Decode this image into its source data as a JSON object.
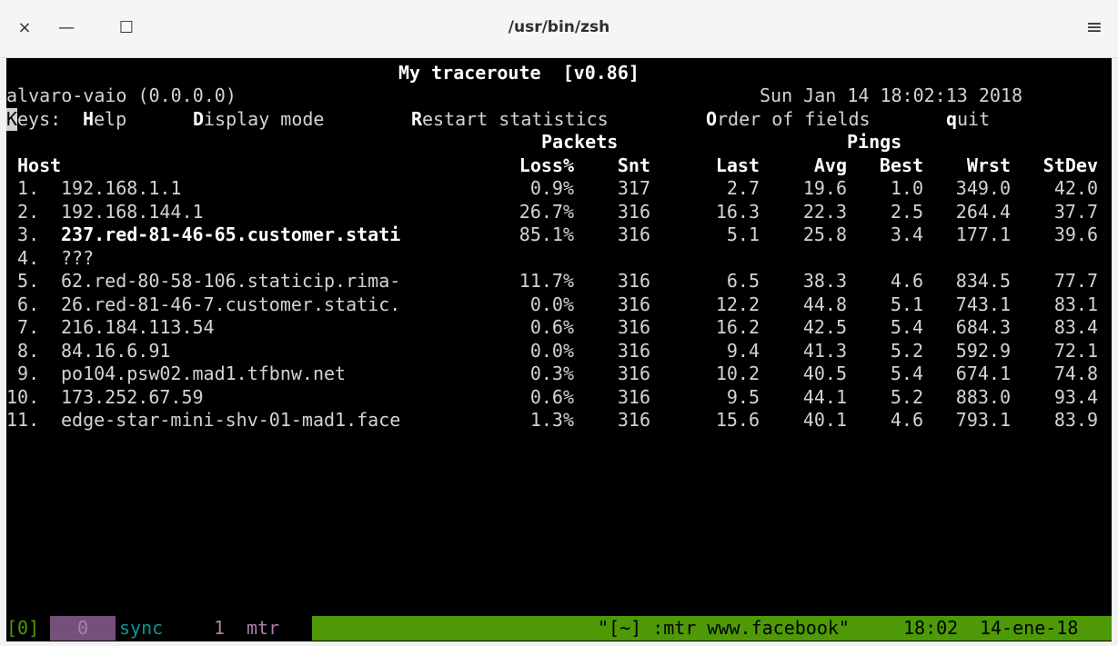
{
  "window": {
    "title": "/usr/bin/zsh",
    "close_glyph": "×",
    "minimize_glyph": "—",
    "maximize_glyph": "☐",
    "menu_glyph": "≡"
  },
  "mtr": {
    "title": "My traceroute  [v0.86]",
    "host_info": "alvaro-vaio (0.0.0.0)",
    "datetime": "Sun Jan 14 18:02:13 2018",
    "keys": {
      "label_first": "K",
      "label_rest": "eys:",
      "help_key": "H",
      "help_rest": "elp",
      "display_key": "D",
      "display_rest": "isplay mode",
      "restart_key": "R",
      "restart_rest": "estart statistics",
      "order_key": "O",
      "order_rest": "rder of fields",
      "quit_key": "q",
      "quit_rest": "uit"
    },
    "group_packets": "Packets",
    "group_pings": "Pings",
    "columns": {
      "host": "Host",
      "loss": "Loss%",
      "snt": "Snt",
      "last": "Last",
      "avg": "Avg",
      "best": "Best",
      "wrst": "Wrst",
      "stdev": "StDev"
    },
    "rows": [
      {
        "n": " 1.",
        "host": "192.168.1.1",
        "loss": "0.9%",
        "snt": "317",
        "last": "2.7",
        "avg": "19.6",
        "best": "1.0",
        "wrst": "349.0",
        "stdev": "42.0"
      },
      {
        "n": " 2.",
        "host": "192.168.144.1",
        "loss": "26.7%",
        "snt": "316",
        "last": "16.3",
        "avg": "22.3",
        "best": "2.5",
        "wrst": "264.4",
        "stdev": "37.7"
      },
      {
        "n": " 3.",
        "host": "237.red-81-46-65.customer.stati",
        "loss": "85.1%",
        "snt": "316",
        "last": "5.1",
        "avg": "25.8",
        "best": "3.4",
        "wrst": "177.1",
        "stdev": "39.6"
      },
      {
        "n": " 4.",
        "host": "???",
        "loss": "",
        "snt": "",
        "last": "",
        "avg": "",
        "best": "",
        "wrst": "",
        "stdev": ""
      },
      {
        "n": " 5.",
        "host": "62.red-80-58-106.staticip.rima-",
        "loss": "11.7%",
        "snt": "316",
        "last": "6.5",
        "avg": "38.3",
        "best": "4.6",
        "wrst": "834.5",
        "stdev": "77.7"
      },
      {
        "n": " 6.",
        "host": "26.red-81-46-7.customer.static.",
        "loss": "0.0%",
        "snt": "316",
        "last": "12.2",
        "avg": "44.8",
        "best": "5.1",
        "wrst": "743.1",
        "stdev": "83.1"
      },
      {
        "n": " 7.",
        "host": "216.184.113.54",
        "loss": "0.6%",
        "snt": "316",
        "last": "16.2",
        "avg": "42.5",
        "best": "5.4",
        "wrst": "684.3",
        "stdev": "83.4"
      },
      {
        "n": " 8.",
        "host": "84.16.6.91",
        "loss": "0.0%",
        "snt": "316",
        "last": "9.4",
        "avg": "41.3",
        "best": "5.2",
        "wrst": "592.9",
        "stdev": "72.1"
      },
      {
        "n": " 9.",
        "host": "po104.psw02.mad1.tfbnw.net",
        "loss": "0.3%",
        "snt": "316",
        "last": "10.2",
        "avg": "40.5",
        "best": "5.4",
        "wrst": "674.1",
        "stdev": "74.8"
      },
      {
        "n": "10.",
        "host": "173.252.67.59",
        "loss": "0.6%",
        "snt": "316",
        "last": "9.5",
        "avg": "44.1",
        "best": "5.2",
        "wrst": "883.0",
        "stdev": "93.4"
      },
      {
        "n": "11.",
        "host": "edge-star-mini-shv-01-mad1.face",
        "loss": "1.3%",
        "snt": "316",
        "last": "15.6",
        "avg": "40.1",
        "best": "4.6",
        "wrst": "793.1",
        "stdev": "83.9"
      }
    ]
  },
  "tmux": {
    "session": "[0]",
    "win0_index": "0",
    "win0_name": "sync",
    "win1_index": "1",
    "win1_name": "mtr",
    "pane_title": "\"[~] :mtr www.facebook\"",
    "time": "18:02",
    "date": "14-ene-18",
    "colors": {
      "bar": "#4e9a06",
      "session_fg": "#4e9a06",
      "win0_bg": "#75507b",
      "win0_name_fg": "#06989a",
      "win1_fg": "#ad7fa8"
    }
  }
}
